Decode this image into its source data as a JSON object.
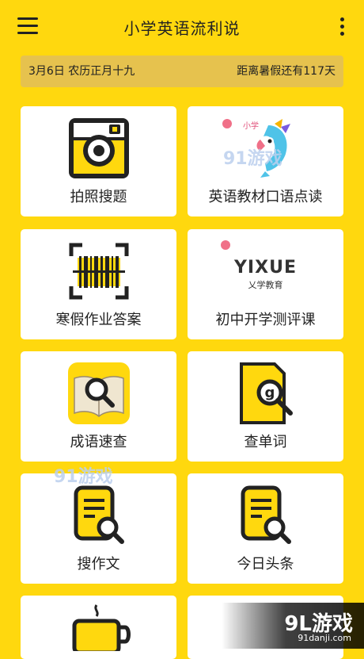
{
  "app": {
    "title": "小学英语流利说"
  },
  "datebar": {
    "left": "3月6日  农历正月十九",
    "right": "距离暑假还有117天"
  },
  "cards": [
    {
      "label": "拍照搜题",
      "icon": "camera-icon"
    },
    {
      "label": "英语教材口语点读",
      "icon": "parrot-icon",
      "tag": "小学"
    },
    {
      "label": "寒假作业答案",
      "icon": "barcode-scan-icon"
    },
    {
      "label": "初中开学测评课",
      "icon": "yixue-logo",
      "brand": "YIXUE",
      "brand_sub": "乂学教育"
    },
    {
      "label": "成语速查",
      "icon": "book-search-icon"
    },
    {
      "label": "查单词",
      "icon": "word-search-icon",
      "letter": "g"
    },
    {
      "label": "搜作文",
      "icon": "essay-search-icon"
    },
    {
      "label": "今日头条",
      "icon": "news-search-icon"
    }
  ],
  "watermarks": {
    "mid": "91游戏",
    "corner_big": "9L游戏",
    "corner_small": "91danji.com"
  },
  "colors": {
    "background": "#FFD80E",
    "datebar": "#E6C24E",
    "card": "#FFFFFF",
    "accent_yellow": "#FFD80E",
    "dark": "#222222",
    "pink": "#F07088"
  }
}
